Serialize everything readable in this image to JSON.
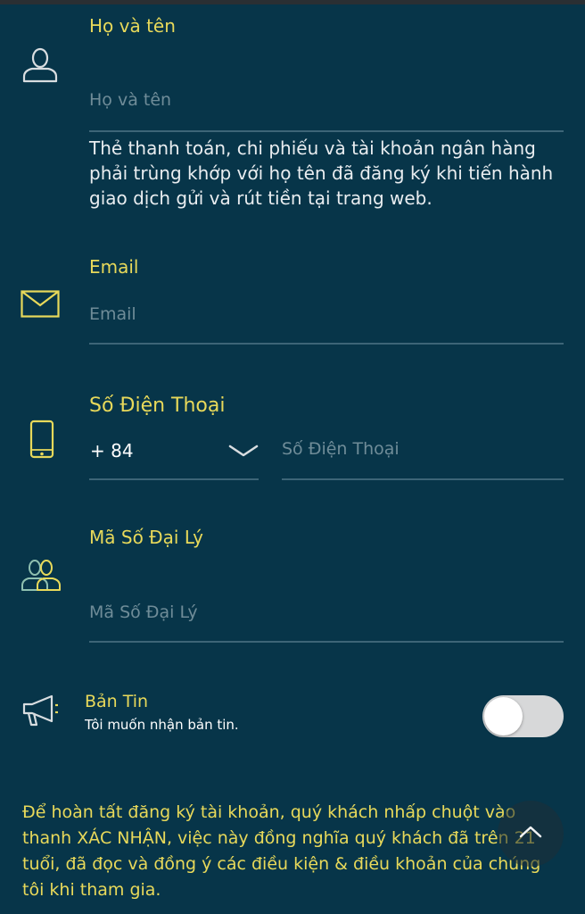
{
  "full_name": {
    "label": "Họ và tên",
    "placeholder": "Họ và tên",
    "note": "Thẻ thanh toán, chi phiếu và tài khoản ngân hàng phải trùng khớp với họ tên đã đăng ký khi tiến hành giao dịch gửi và rút tiền tại trang web."
  },
  "email": {
    "label": "Email",
    "placeholder": "Email"
  },
  "phone": {
    "label": "Số Điện Thoại",
    "prefix": "+ 84",
    "placeholder": "Số Điện Thoại"
  },
  "agent_code": {
    "label": "Mã Số Đại Lý",
    "placeholder": "Mã Số Đại Lý"
  },
  "newsletter": {
    "title": "Bản Tin",
    "subtitle": "Tôi muốn nhận bản tin.",
    "enabled": false
  },
  "footer_text": "Để hoàn tất đăng ký tài khoản, quý khách nhấp chuột vào thanh XÁC NHẬN, việc này đồng nghĩa quý khách đã trên 21 tuổi, đã đọc và đồng ý các điều kiện & điều khoản của chúng tôi khi tham gia.",
  "icons": {
    "name": "user-icon",
    "email": "envelope-icon",
    "phone": "mobile-phone-icon",
    "agent": "users-icon",
    "newsletter": "megaphone-icon",
    "scroll_top": "chevron-up-icon"
  },
  "colors": {
    "background": "#073549",
    "label": "#e8d95a",
    "placeholder": "#6f8c98",
    "underline": "#3d6577"
  }
}
